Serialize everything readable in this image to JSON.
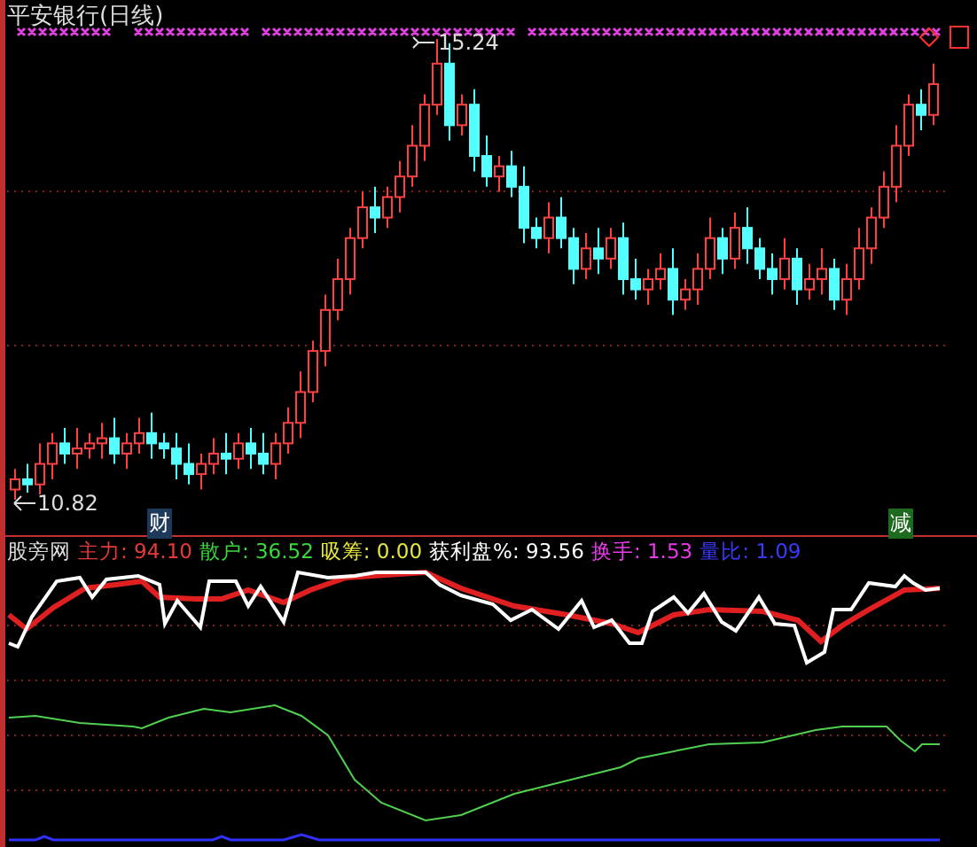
{
  "main_chart": {
    "title": "平安银行(日线)",
    "high_label": "15.24",
    "low_label": "10.82",
    "event_markers": [
      {
        "text": "财",
        "color": "#1e3a5a"
      },
      {
        "text": "减",
        "color": "#1e6a1e"
      }
    ]
  },
  "indicator": {
    "name": "股旁网",
    "legend": [
      {
        "text": "主力: 94.10",
        "color": "#e83a3a"
      },
      {
        "text": "散户: 36.52",
        "color": "#3ad83a"
      },
      {
        "text": "吸筹: 0.00",
        "color": "#e8e83a"
      },
      {
        "text": "获利盘%: 93.56",
        "color": "#ffffff"
      },
      {
        "text": "换手: 1.53",
        "color": "#e83ae8"
      },
      {
        "text": "量比: 1.09",
        "color": "#3a3aff"
      }
    ]
  }
}
